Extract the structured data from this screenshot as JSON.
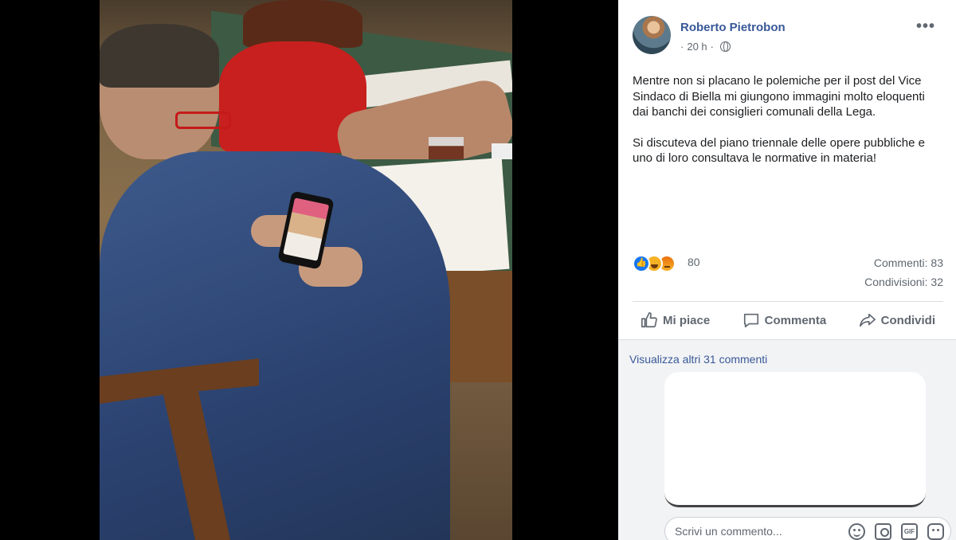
{
  "post": {
    "author": "Roberto Pietrobon",
    "time": "20 h",
    "separator": "·",
    "paragraphs": [
      "Mentre non si placano le polemiche per il post del Vice Sindaco di Biella mi giungono immagini molto eloquenti dai banchi dei consiglieri comunali della Lega.",
      "Si discuteva del piano triennale delle opere pubbliche e uno di loro consultava le normative in materia!"
    ],
    "more_icon": "more-horizontal-icon",
    "privacy_icon": "globe-icon"
  },
  "stats": {
    "reaction_count": "80",
    "reactions": [
      "like",
      "haha",
      "angry"
    ],
    "comments": "Commenti: 83",
    "shares": "Condivisioni: 32"
  },
  "actions": {
    "like": "Mi piace",
    "comment": "Commenta",
    "share": "Condividi"
  },
  "comments": {
    "view_more": "Visualizza altri 31 commenti",
    "input_placeholder": "Scrivi un commento...",
    "gif_label": "GIF"
  },
  "colors": {
    "link": "#385898",
    "secondary_text": "#606770",
    "like_blue": "#1877f2",
    "viewer_bg": "#000000"
  }
}
